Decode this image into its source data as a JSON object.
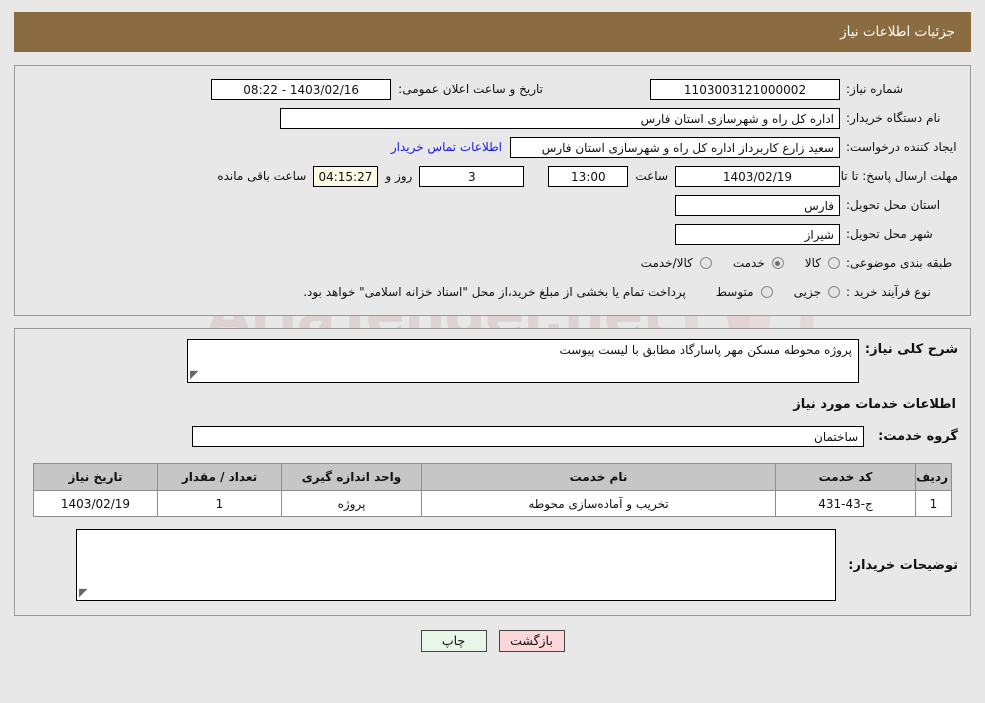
{
  "header": {
    "title": "جزئیات اطلاعات نیاز"
  },
  "watermark": {
    "text": "AriaTender.net"
  },
  "info": {
    "need_number_label": "شماره نیاز:",
    "need_number_value": "1103003121000002",
    "announce_label": "تاریخ و ساعت اعلان عمومی:",
    "announce_value": "1403/02/16 - 08:22",
    "buyer_org_label": "نام دستگاه خریدار:",
    "buyer_org_value": "اداره کل راه و شهرسازی استان فارس",
    "creator_label": "ایجاد کننده درخواست:",
    "creator_value": "سعید زارع کاربرداز اداره کل راه و شهرسازی استان فارس",
    "contact_link": "اطلاعات تماس خریدار",
    "deadline_label": "مهلت ارسال پاسخ: تا تاریخ:",
    "deadline_date": "1403/02/19",
    "time_label": "ساعت",
    "deadline_time": "13:00",
    "days_value": "3",
    "days_label": "روز و",
    "countdown_value": "04:15:27",
    "remaining_label": "ساعت باقی مانده",
    "province_label": "استان محل تحویل:",
    "province_value": "فارس",
    "city_label": "شهر محل تحویل:",
    "city_value": "شیراز",
    "category_label": "طبقه بندی موضوعی:",
    "category_options": [
      {
        "label": "کالا",
        "selected": false
      },
      {
        "label": "خدمت",
        "selected": true
      },
      {
        "label": "کالا/خدمت",
        "selected": false
      }
    ],
    "process_label": "نوع فرآیند خرید :",
    "process_options": [
      {
        "label": "جزیی",
        "selected": false
      },
      {
        "label": "متوسط",
        "selected": false
      }
    ],
    "process_note": "پرداخت تمام یا بخشی از مبلغ خرید،از محل \"اسناد خزانه اسلامی\" خواهد بود."
  },
  "details": {
    "summary_label": "شرح کلی نیاز:",
    "summary_value": "پروژه محوطه مسکن مهر پاسارگاد مطابق با لیست پیوست",
    "services_heading": "اطلاعات خدمات مورد نیاز",
    "service_group_label": "گروه خدمت:",
    "service_group_value": "ساختمان",
    "buyer_notes_label": "توضیحات خریدار:",
    "buyer_notes_value": ""
  },
  "table": {
    "columns": [
      "ردیف",
      "کد خدمت",
      "نام خدمت",
      "واحد اندازه گیری",
      "تعداد / مقدار",
      "تاریخ نیاز"
    ],
    "rows": [
      {
        "radif": "1",
        "code": "ج-43-431",
        "name": "تخریب و آماده‌سازی محوطه",
        "unit": "پروژه",
        "qty": "1",
        "date": "1403/02/19"
      }
    ]
  },
  "footer": {
    "print_label": "چاپ",
    "back_label": "بازگشت"
  },
  "colors": {
    "header_bg": "#8b6c42",
    "link": "#1919e6",
    "back_btn": "#fbd6d6",
    "print_btn": "#e8f6e8",
    "countdown_bg": "#fdfbe6",
    "table_header_bg": "#c6c6c6",
    "page_bg": "#e8e8e8"
  }
}
